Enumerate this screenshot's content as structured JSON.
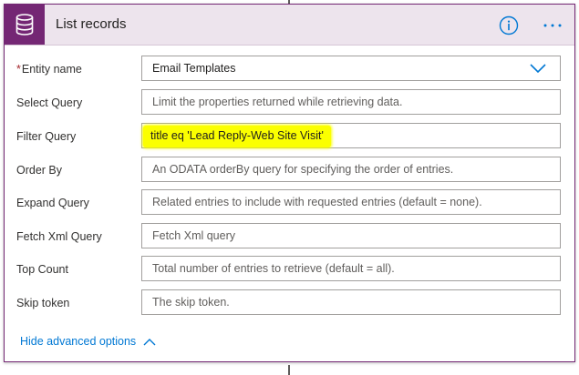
{
  "header": {
    "title": "List records",
    "icon": "database-icon",
    "accent": "#742774",
    "info_icon": "info-icon",
    "more_icon": "more-options-icon"
  },
  "fields": {
    "entity_name": {
      "label": "Entity name",
      "required_mark": "*",
      "value": "Email Templates"
    },
    "select_query": {
      "label": "Select Query",
      "placeholder": "Limit the properties returned while retrieving data."
    },
    "filter_query": {
      "label": "Filter Query",
      "value": "title eq 'Lead Reply-Web Site Visit'"
    },
    "order_by": {
      "label": "Order By",
      "placeholder": "An ODATA orderBy query for specifying the order of entries."
    },
    "expand_query": {
      "label": "Expand Query",
      "placeholder": "Related entries to include with requested entries (default = none)."
    },
    "fetch_xml_query": {
      "label": "Fetch Xml Query",
      "placeholder": "Fetch Xml query"
    },
    "top_count": {
      "label": "Top Count",
      "placeholder": "Total number of entries to retrieve (default = all)."
    },
    "skip_token": {
      "label": "Skip token",
      "placeholder": "The skip token."
    }
  },
  "footer": {
    "advanced_label": "Hide advanced options"
  },
  "colors": {
    "link": "#0078d4",
    "highlight": "#fbff00",
    "header_bg": "#ede4ed"
  }
}
